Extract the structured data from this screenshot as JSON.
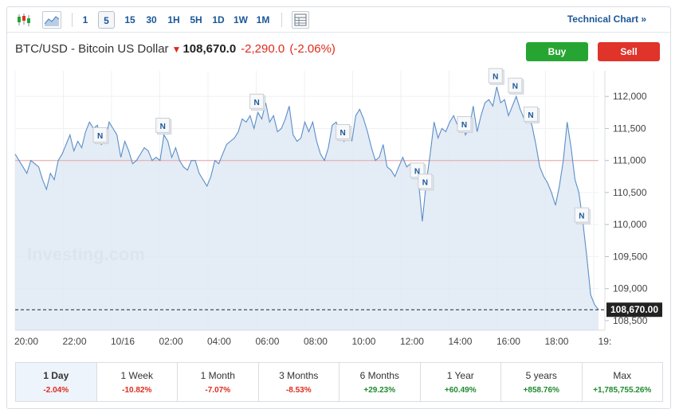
{
  "toolbar": {
    "icons": [
      "candlestick-icon",
      "area-chart-icon",
      "table-icon"
    ],
    "timeframes": [
      "1",
      "5",
      "15",
      "30",
      "1H",
      "5H",
      "1D",
      "1W",
      "1M"
    ],
    "active_timeframe": "5",
    "technical_chart_label": "Technical Chart »"
  },
  "header": {
    "symbol": "BTC/USD - Bitcoin US Dollar",
    "direction_icon": "down-arrow-icon",
    "price": "108,670.0",
    "change": "-2,290.0",
    "change_pct": "(-2.06%)",
    "buy_label": "Buy",
    "sell_label": "Sell"
  },
  "chart_data": {
    "type": "area",
    "watermark": "Investing.com",
    "y_ticks": [
      "112,000",
      "111,500",
      "111,000",
      "110,500",
      "110,000",
      "109,500",
      "109,000",
      "108,500"
    ],
    "y_range": [
      108350,
      112400
    ],
    "x_ticks": [
      "20:00",
      "22:00",
      "10/16",
      "02:00",
      "04:00",
      "06:00",
      "08:00",
      "10:00",
      "12:00",
      "14:00",
      "16:00",
      "18:00",
      "19:"
    ],
    "reference_line": 111000,
    "last_price_label": "108,670.00",
    "last_price": 108670,
    "news_marker_label": "N",
    "series": [
      {
        "values": [
          111100,
          111000,
          110900,
          110800,
          111000,
          110950,
          110900,
          110700,
          110550,
          110800,
          110700,
          111000,
          111100,
          111250,
          111400,
          111150,
          111300,
          111200,
          111450,
          111600,
          111500,
          111550,
          111250,
          111300,
          111600,
          111500,
          111400,
          111050,
          111300,
          111150,
          110950,
          111000,
          111100,
          111200,
          111150,
          111000,
          111050,
          111000,
          111400,
          111300,
          111050,
          111200,
          111000,
          110900,
          110850,
          111000,
          111000,
          110800,
          110700,
          110600,
          110750,
          111000,
          110950,
          111100,
          111250,
          111300,
          111350,
          111450,
          111650,
          111600,
          111700,
          111500,
          111750,
          111650,
          111900,
          111600,
          111700,
          111450,
          111500,
          111650,
          111850,
          111400,
          111300,
          111350,
          111600,
          111450,
          111600,
          111300,
          111100,
          111000,
          111200,
          111550,
          111600,
          111450,
          111300,
          111500,
          111300,
          111700,
          111800,
          111650,
          111450,
          111200,
          111000,
          111050,
          111250,
          110900,
          110850,
          110750,
          110900,
          111050,
          110900,
          110950,
          110850,
          110700,
          110050,
          110650,
          111100,
          111600,
          111350,
          111500,
          111450,
          111600,
          111700,
          111550,
          111650,
          111400,
          111500,
          111850,
          111450,
          111700,
          111900,
          111950,
          111850,
          112150,
          111900,
          111950,
          111700,
          111850,
          112000,
          111800,
          111650,
          111700,
          111550,
          111250,
          110900,
          110750,
          110650,
          110500,
          110300,
          110600,
          111000,
          111600,
          111200,
          110700,
          110500,
          110050,
          109500,
          108900,
          108750,
          108670
        ]
      }
    ]
  },
  "periods": [
    {
      "label": "1 Day",
      "value": "-2.04%",
      "dir": "neg"
    },
    {
      "label": "1 Week",
      "value": "-10.82%",
      "dir": "neg"
    },
    {
      "label": "1 Month",
      "value": "-7.07%",
      "dir": "neg"
    },
    {
      "label": "3 Months",
      "value": "-8.53%",
      "dir": "neg"
    },
    {
      "label": "6 Months",
      "value": "+29.23%",
      "dir": "pos"
    },
    {
      "label": "1 Year",
      "value": "+60.49%",
      "dir": "pos"
    },
    {
      "label": "5 years",
      "value": "+858.76%",
      "dir": "pos"
    },
    {
      "label": "Max",
      "value": "+1,785,755.26%",
      "dir": "pos"
    }
  ]
}
